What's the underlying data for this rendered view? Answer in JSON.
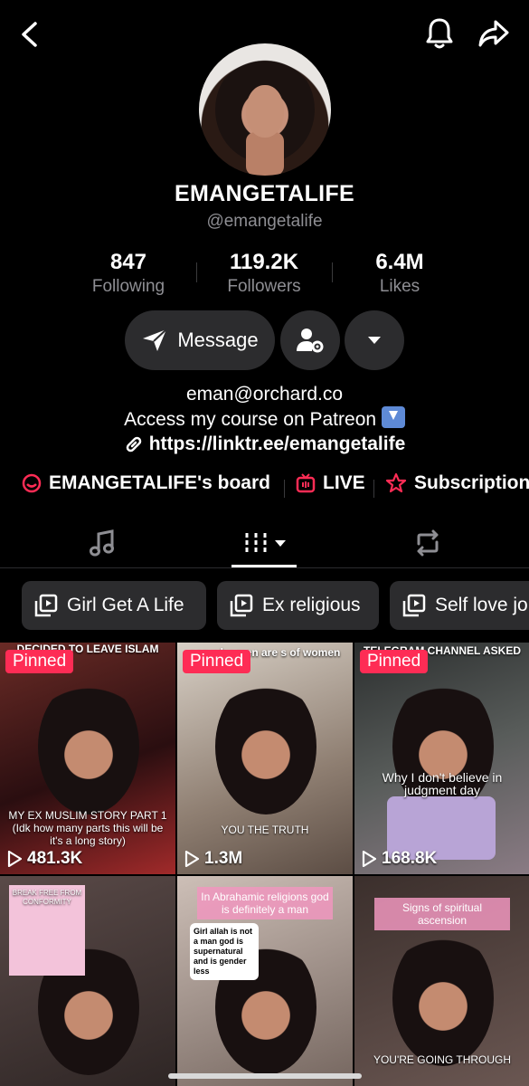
{
  "profile": {
    "display_name": "EMANGETALIFE",
    "handle": "@emangetalife"
  },
  "stats": [
    {
      "value": "847",
      "label": "Following"
    },
    {
      "value": "119.2K",
      "label": "Followers"
    },
    {
      "value": "6.4M",
      "label": "Likes"
    }
  ],
  "actions": {
    "message_label": "Message"
  },
  "bio": {
    "line1": "eman@orchard.co",
    "line2": "Access my course on Patreon",
    "link": "https://linktr.ee/emangetalife"
  },
  "links": [
    {
      "label": "EMANGETALIFE's board",
      "icon": "board-icon"
    },
    {
      "label": "LIVE",
      "icon": "live-icon"
    },
    {
      "label": "Subscription",
      "icon": "subscription-icon"
    }
  ],
  "playlists": [
    {
      "label": "Girl Get A Life"
    },
    {
      "label": "Ex religious"
    },
    {
      "label": "Self love jo"
    }
  ],
  "videos": [
    {
      "pinned": "Pinned",
      "views": "481.3K",
      "caption_top": "DECIDED TO LEAVE ISLAM",
      "caption_mid": "MY EX MUSLIM STORY PART 1 (Idk how many parts this will be it's a long story)"
    },
    {
      "pinned": "Pinned",
      "views": "1.3M",
      "caption_top": "son why men are s of women",
      "caption_mid": "YOU THE TRUTH"
    },
    {
      "pinned": "Pinned",
      "views": "168.8K",
      "caption_top": "TELEGRAM CHANNEL ASKED",
      "caption_mid": "Why I don't believe in judgment day"
    },
    {
      "caption_top": "BREAK FREE FROM CONFORMITY"
    },
    {
      "caption_top": "In Abrahamic religions god is definitely a man",
      "card": "Girl allah is not a man god is supernatural and is gender less"
    },
    {
      "caption_top": "Signs of spiritual ascension",
      "caption_bottom": "YOU'RE GOING THROUGH"
    }
  ],
  "colors": {
    "background": "#000000",
    "accent": "#fe2c55",
    "button_bg": "#2c2c2e",
    "muted_text": "#8e8e93"
  }
}
